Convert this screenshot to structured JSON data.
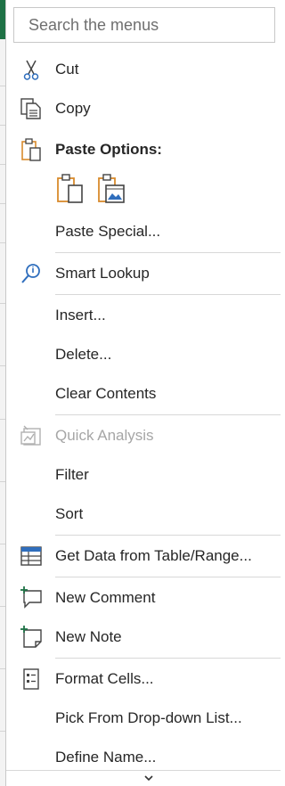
{
  "search": {
    "placeholder": "Search the menus"
  },
  "menu": {
    "items": {
      "cut": "Cut",
      "copy": "Copy",
      "paste_options": "Paste Options:",
      "paste_special": "Paste Special...",
      "smart_lookup": "Smart Lookup",
      "insert": "Insert...",
      "delete": "Delete...",
      "clear_contents": "Clear Contents",
      "quick_analysis": "Quick Analysis",
      "filter": "Filter",
      "sort": "Sort",
      "get_data": "Get Data from Table/Range...",
      "new_comment": "New Comment",
      "new_note": "New Note",
      "format_cells": "Format Cells...",
      "pick_from_list": "Pick From Drop-down List...",
      "define_name": "Define Name..."
    }
  },
  "icons": {
    "cut": "scissors-icon",
    "copy": "copy-icon",
    "paste": "clipboard-icon",
    "paste_keep": "paste-clipboard-icon",
    "paste_picture": "paste-picture-icon",
    "smart_lookup": "magnifier-icon",
    "quick_analysis": "quick-analysis-icon",
    "get_data": "table-icon",
    "new_comment": "new-comment-icon",
    "new_note": "new-note-icon",
    "format_cells": "format-cells-icon",
    "scroll_down": "chevron-down-icon"
  },
  "colors": {
    "accent_orange": "#d88a2c",
    "accent_blue": "#2f6ebd",
    "accent_green": "#1e7145",
    "text": "#262626",
    "disabled": "#a6a6a6"
  }
}
